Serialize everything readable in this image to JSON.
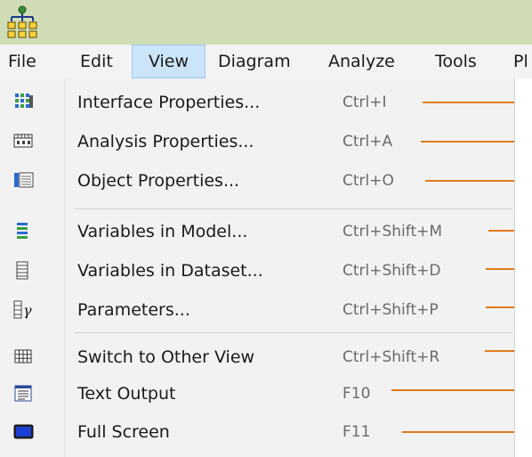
{
  "menubar": {
    "items": [
      {
        "label": "File"
      },
      {
        "label": "Edit"
      },
      {
        "label": "View"
      },
      {
        "label": "Diagram"
      },
      {
        "label": "Analyze"
      },
      {
        "label": "Tools"
      },
      {
        "label": "Pl"
      }
    ],
    "active": "View"
  },
  "view_menu": {
    "items": [
      {
        "label": "Interface Properties...",
        "shortcut": "Ctrl+I",
        "icon": "interface-properties-icon"
      },
      {
        "label": "Analysis Properties...",
        "shortcut": "Ctrl+A",
        "icon": "analysis-properties-icon"
      },
      {
        "label": "Object Properties...",
        "shortcut": "Ctrl+O",
        "icon": "object-properties-icon"
      },
      {
        "label": "Variables in Model...",
        "shortcut": "Ctrl+Shift+M",
        "icon": "variables-in-model-icon"
      },
      {
        "label": "Variables in Dataset...",
        "shortcut": "Ctrl+Shift+D",
        "icon": "variables-in-dataset-icon"
      },
      {
        "label": "Parameters...",
        "shortcut": "Ctrl+Shift+P",
        "icon": "parameters-gamma-icon"
      },
      {
        "label": "Switch to Other View",
        "shortcut": "Ctrl+Shift+R",
        "icon": "grid-view-icon"
      },
      {
        "label": "Text Output",
        "shortcut": "F10",
        "icon": "text-output-icon"
      },
      {
        "label": "Full Screen",
        "shortcut": "F11",
        "icon": "full-screen-icon"
      }
    ]
  },
  "colors": {
    "titlebar": "#cfdcb5",
    "menu_highlight": "#cce4f7",
    "annotation_line": "#e07a1a"
  }
}
